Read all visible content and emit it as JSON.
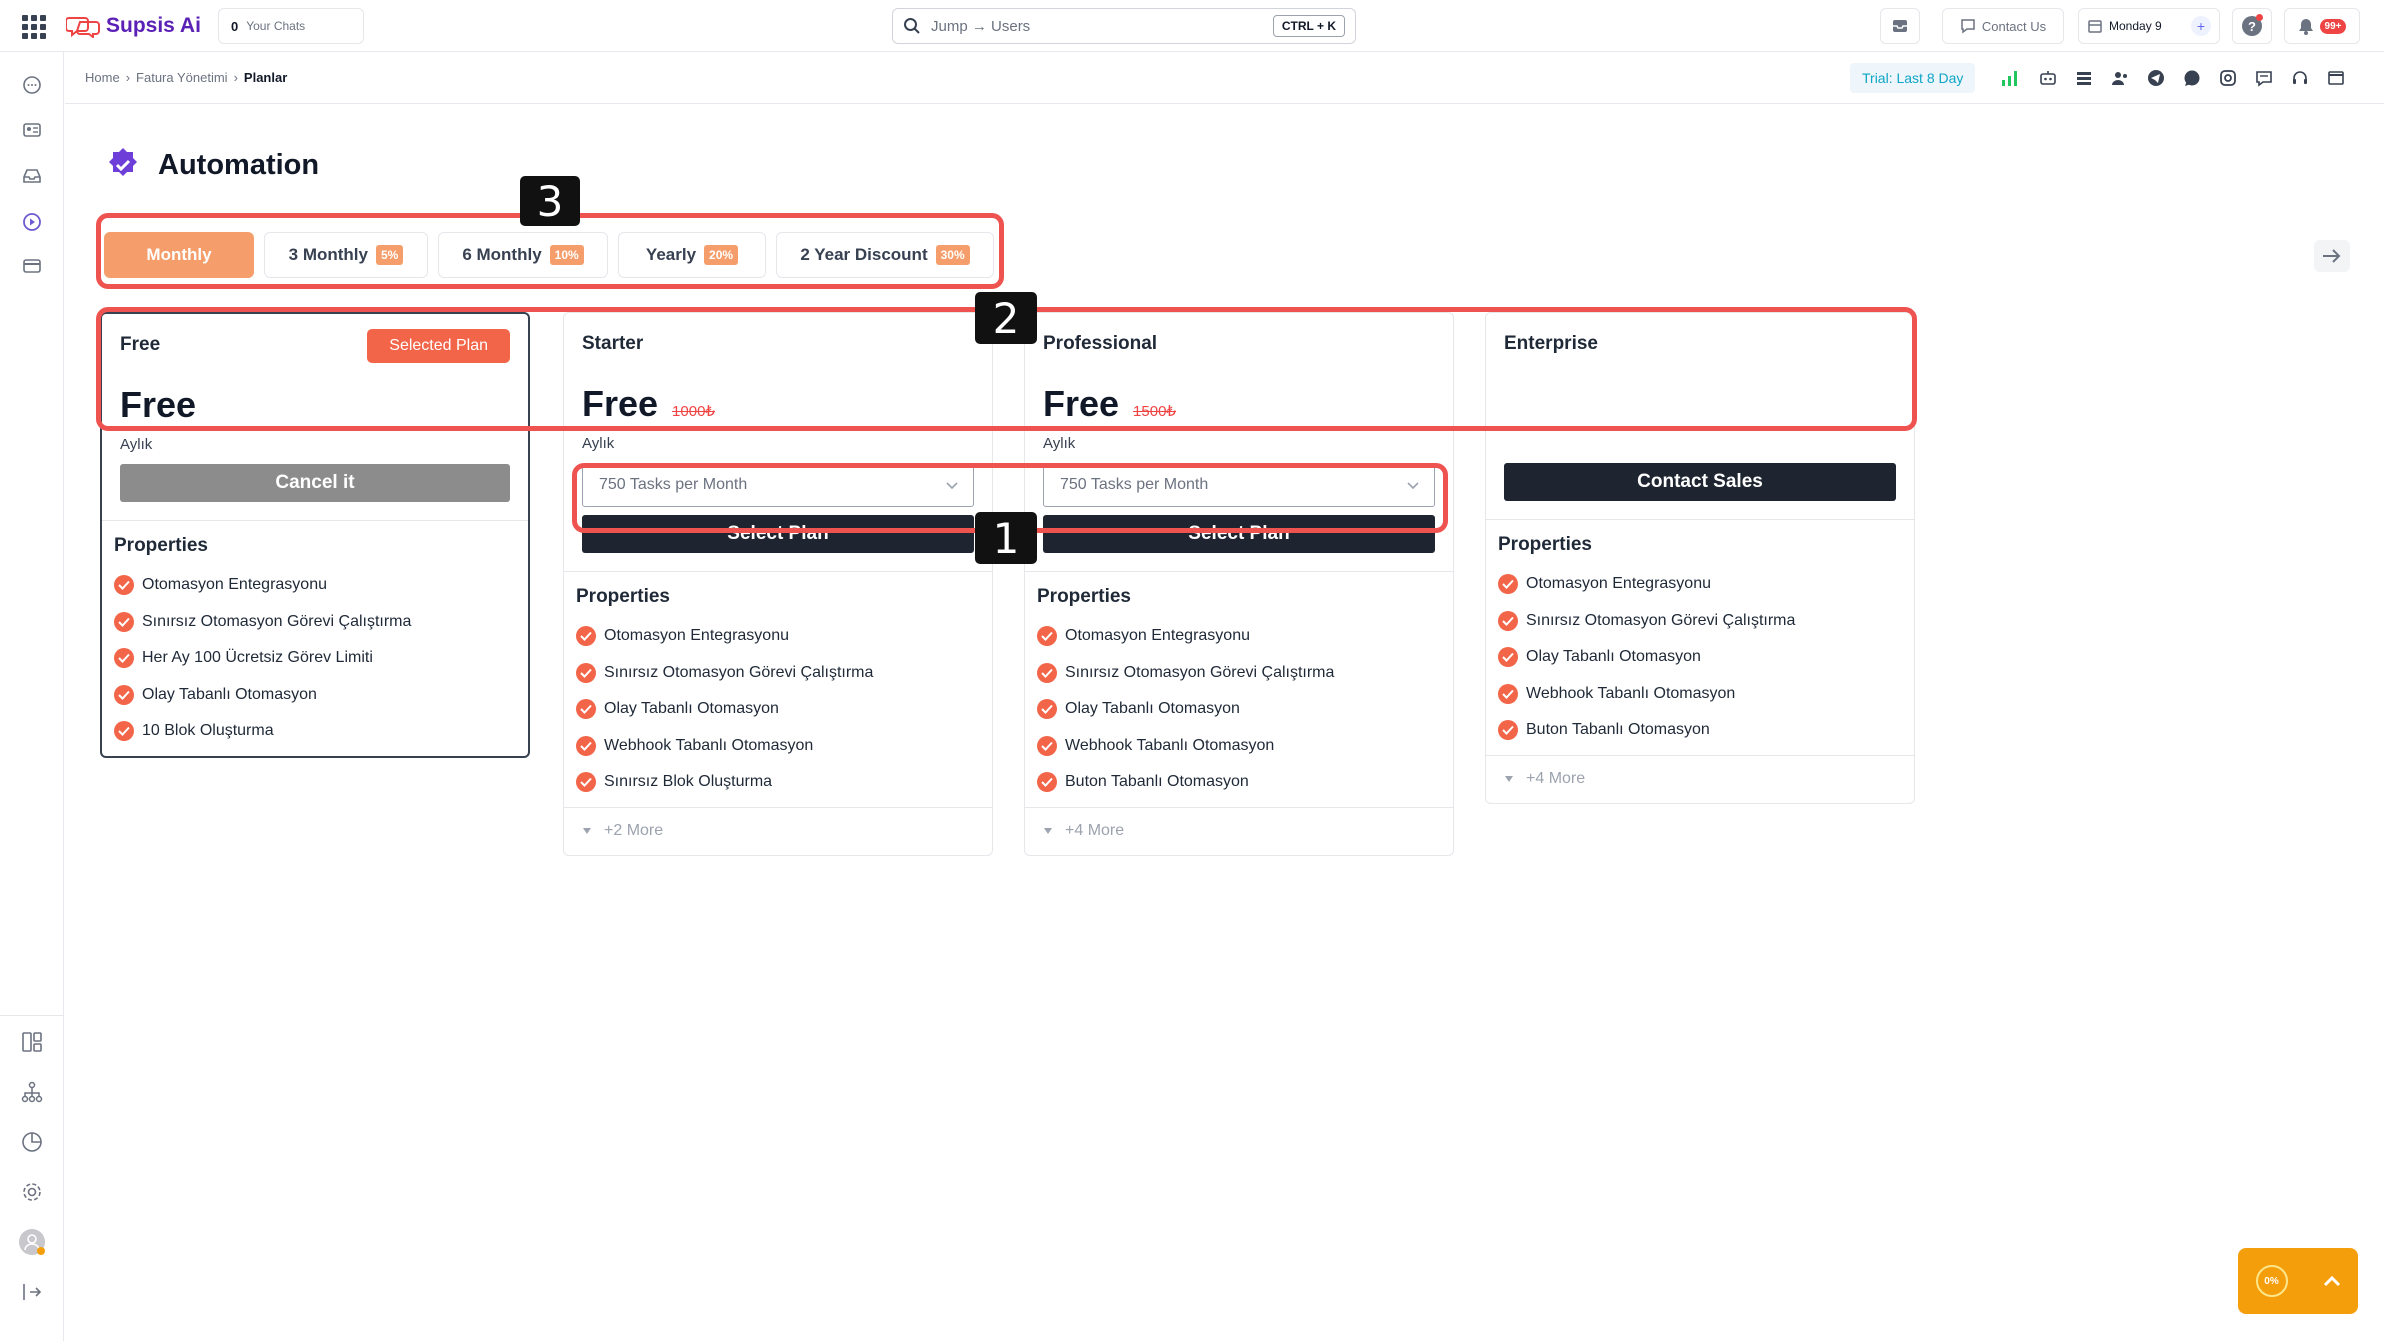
{
  "app": {
    "name": "Supsis Ai",
    "your_chats_count": "0",
    "your_chats_label": "Your Chats",
    "search_placeholder": "Jump → Users",
    "search_shortcut": "CTRL + K",
    "contact_us": "Contact Us",
    "day_label": "Monday 9",
    "notifications_badge": "99+"
  },
  "breadcrumb": [
    "Home",
    "Fatura Yönetimi",
    "Planlar"
  ],
  "trial": "Trial: Last 8 Day",
  "page": {
    "title": "Automation"
  },
  "period_tabs": [
    {
      "label": "Monthly",
      "discount": "",
      "active": true
    },
    {
      "label": "3 Monthly",
      "discount": "5%"
    },
    {
      "label": "6 Monthly",
      "discount": "10%"
    },
    {
      "label": "Yearly",
      "discount": "20%"
    },
    {
      "label": "2 Year Discount",
      "discount": "30%"
    }
  ],
  "plans": [
    {
      "name": "Free",
      "badge": "Selected Plan",
      "price": "Free",
      "old_price": "",
      "period": "Aylık",
      "button": "Cancel it",
      "properties_title": "Properties",
      "properties": [
        "Otomasyon Entegrasyonu",
        "Sınırsız Otomasyon Görevi Çalıştırma",
        "Her Ay 100 Ücretsiz Görev Limiti",
        "Olay Tabanlı Otomasyon",
        "10 Blok Oluşturma"
      ]
    },
    {
      "name": "Starter",
      "price": "Free",
      "old_price": "1000₺",
      "period": "Aylık",
      "select_value": "750 Tasks per Month",
      "button": "Select Plan",
      "properties_title": "Properties",
      "properties": [
        "Otomasyon Entegrasyonu",
        "Sınırsız Otomasyon Görevi Çalıştırma",
        "Olay Tabanlı Otomasyon",
        "Webhook Tabanlı Otomasyon",
        "Sınırsız Blok Oluşturma"
      ],
      "more": "+2 More"
    },
    {
      "name": "Professional",
      "price": "Free",
      "old_price": "1500₺",
      "period": "Aylık",
      "select_value": "750 Tasks per Month",
      "button": "Select Plan",
      "properties_title": "Properties",
      "properties": [
        "Otomasyon Entegrasyonu",
        "Sınırsız Otomasyon Görevi Çalıştırma",
        "Olay Tabanlı Otomasyon",
        "Webhook Tabanlı Otomasyon",
        "Buton Tabanlı Otomasyon"
      ],
      "more": "+4 More"
    },
    {
      "name": "Enterprise",
      "button": "Contact Sales",
      "properties_title": "Properties",
      "properties": [
        "Otomasyon Entegrasyonu",
        "Sınırsız Otomasyon Görevi Çalıştırma",
        "Olay Tabanlı Otomasyon",
        "Webhook Tabanlı Otomasyon",
        "Buton Tabanlı Otomasyon"
      ],
      "more": "+4 More"
    }
  ],
  "annotations": [
    "1",
    "2",
    "3"
  ],
  "progress": "0%",
  "colors": {
    "accent": "#f59e6b",
    "selected_badge": "#f26549",
    "dark_button": "#1f2530",
    "annotation": "#ef5350"
  }
}
